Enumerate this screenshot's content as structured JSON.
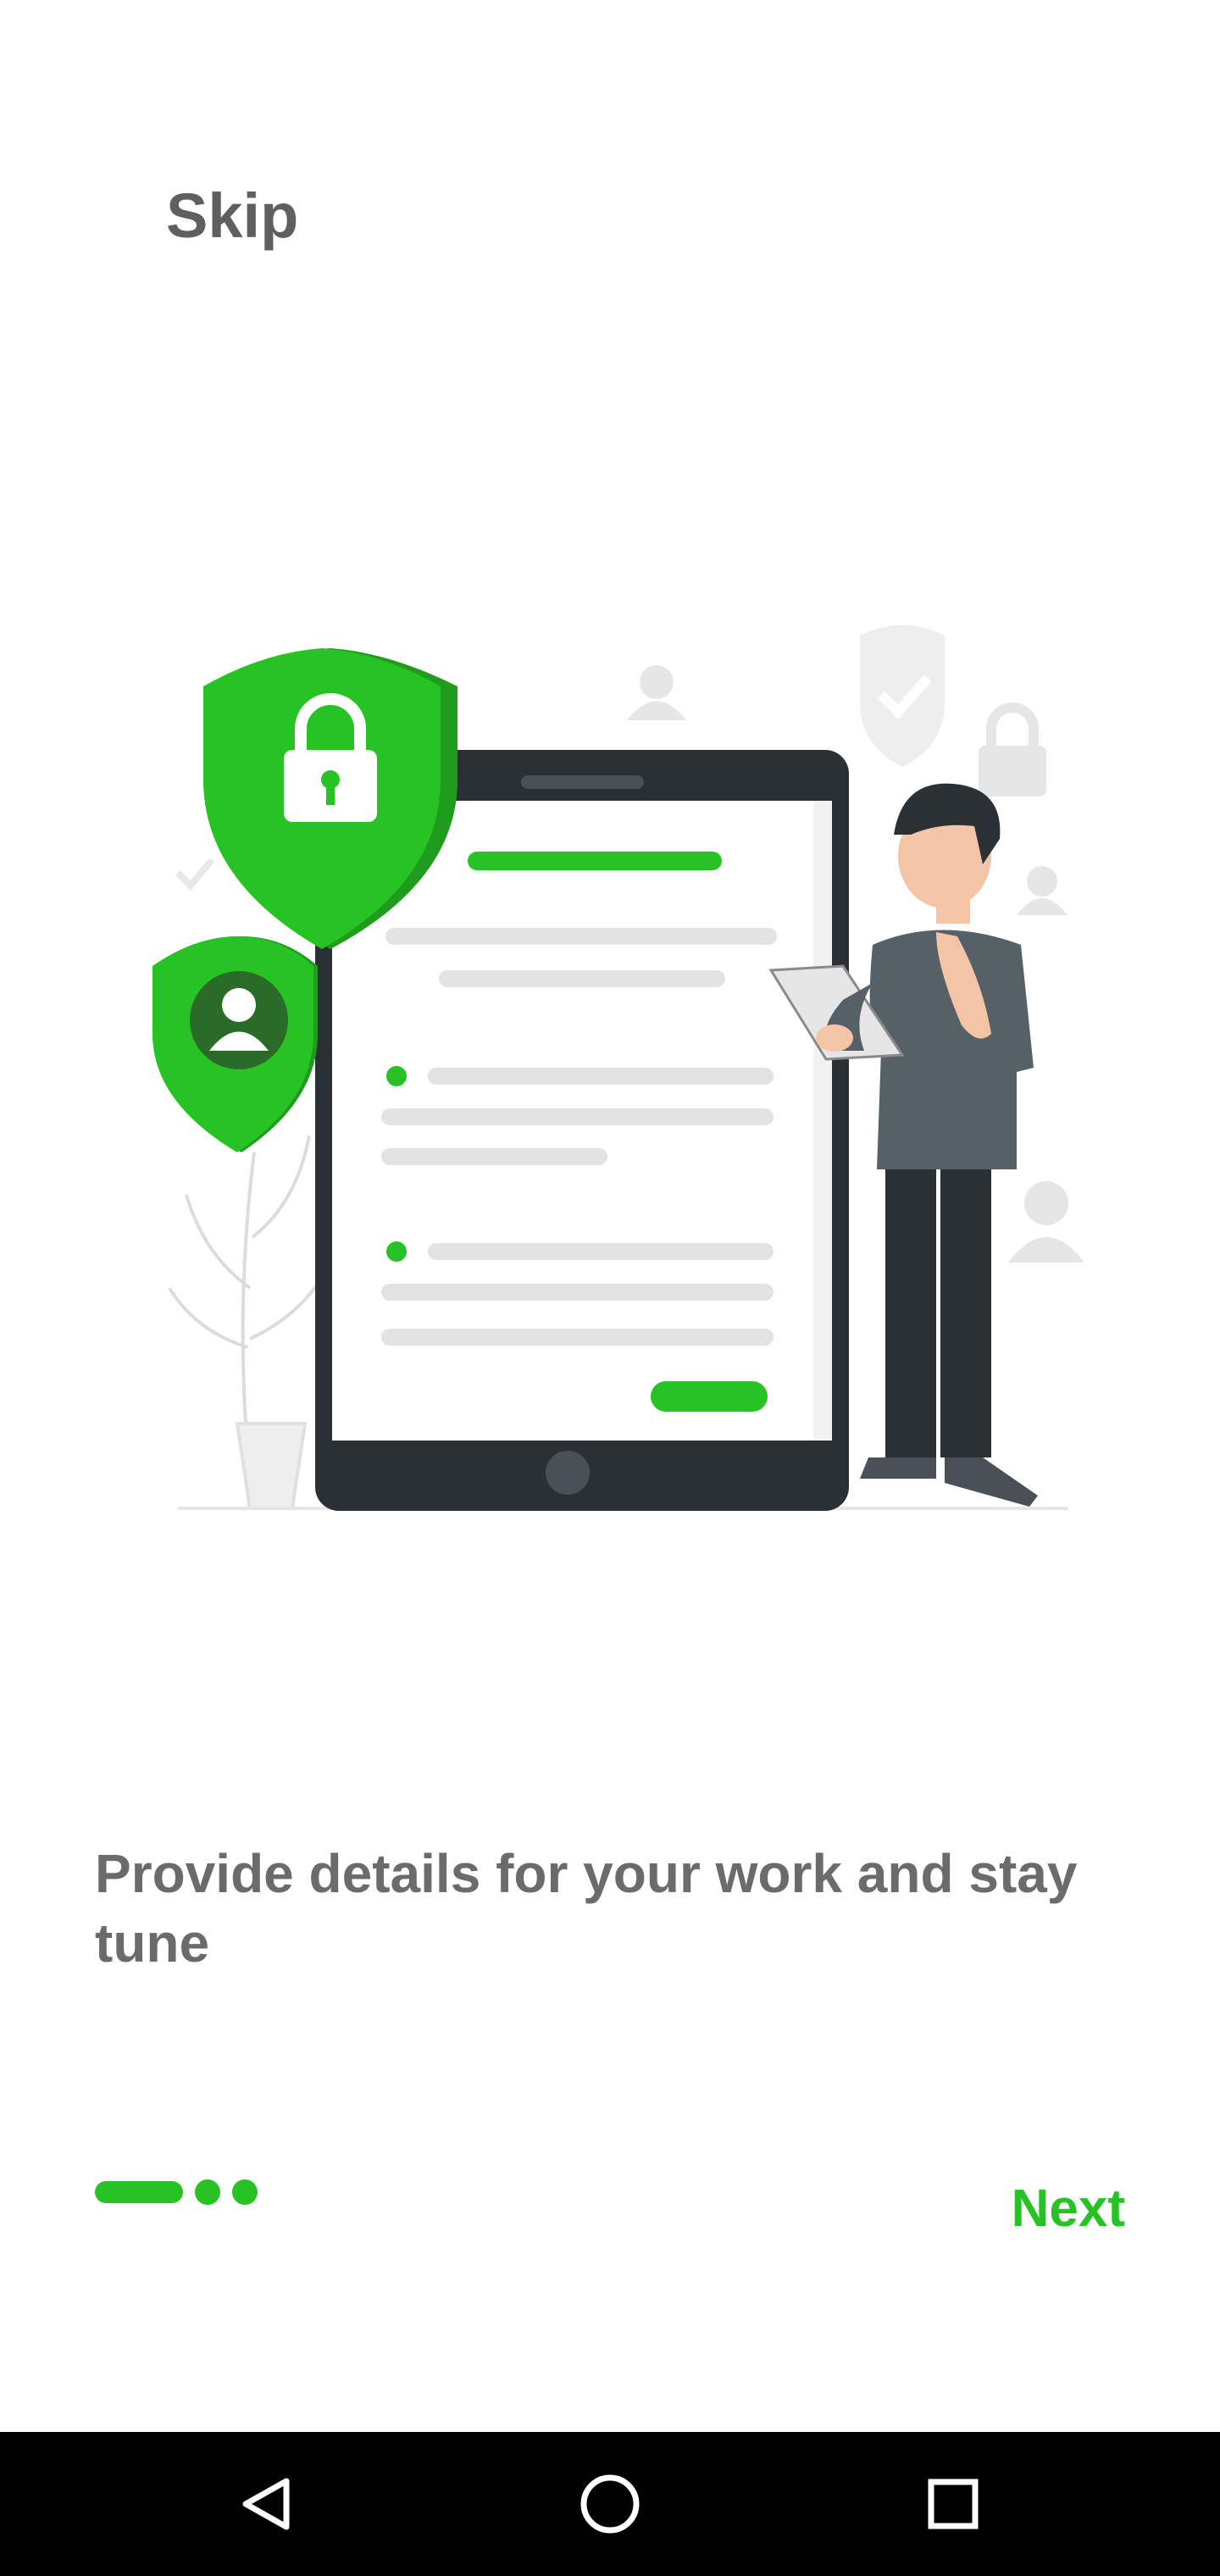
{
  "onboarding": {
    "skip_label": "Skip",
    "headline": "Provide details for your work and stay tune",
    "next_label": "Next",
    "page_indicator": {
      "current": 1,
      "total": 3
    }
  },
  "illustration": {
    "name": "security-form-illustration",
    "accent_color": "#27c224"
  },
  "system_nav": {
    "back": "back-icon",
    "home": "home-icon",
    "recents": "recents-icon"
  },
  "colors": {
    "accent": "#27c224",
    "text": "#5f5f5f",
    "navbar": "#000000"
  }
}
